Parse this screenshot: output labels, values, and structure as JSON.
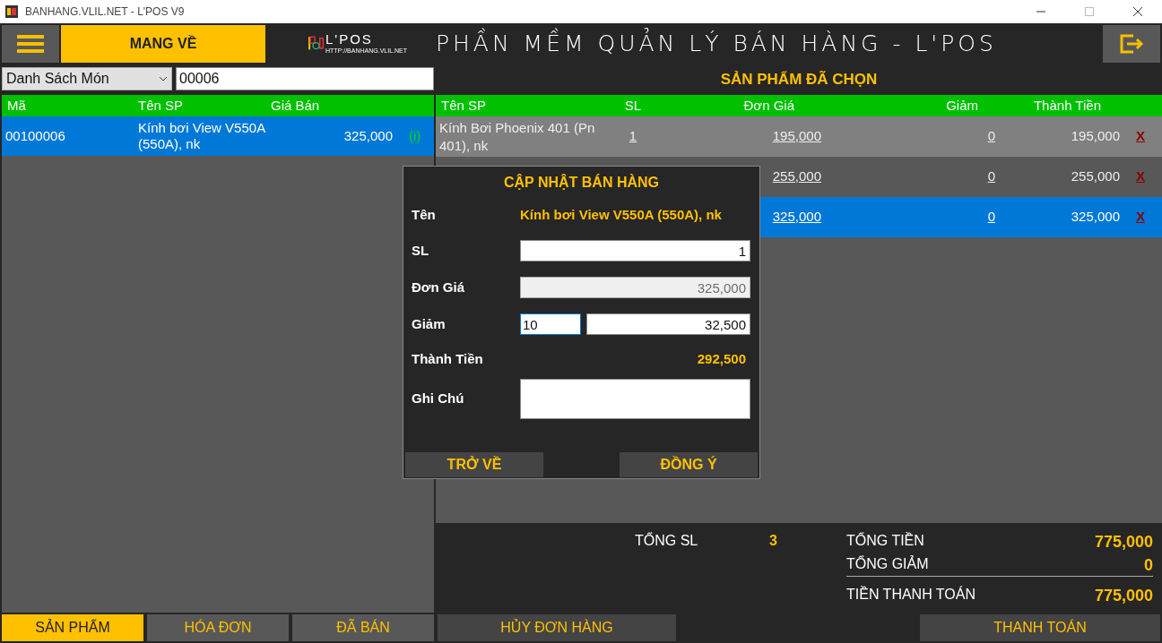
{
  "window": {
    "title": "BANHANG.VLIL.NET - L'POS V9"
  },
  "top_bar": {
    "order_type": "MANG VỀ",
    "logo_text": "L'POS",
    "logo_url": "HTTP://BANHANG.VLIL.NET",
    "app_title": "PHẦN MỀM QUẢN LÝ BÁN HÀNG - L'POS"
  },
  "product_panel": {
    "category": "Danh Sách Món",
    "search": "00006",
    "columns": [
      "Mã",
      "Tên SP",
      "Giá Bán"
    ],
    "rows": [
      {
        "code": "00100006",
        "name": "Kính bơi View V550A (550A), nk",
        "price": "325,000",
        "info": "(i)",
        "selected": true
      }
    ]
  },
  "cart": {
    "title": "SẢN PHẨM ĐÃ CHỌN",
    "columns": [
      "Tên SP",
      "SL",
      "Đơn Giá",
      "Giảm",
      "Thành Tiền"
    ],
    "rows": [
      {
        "name": "Kính Bơi Phoenix 401 (Pn 401), nk",
        "qty": "1",
        "unit_price": "195,000",
        "discount": "0",
        "total": "195,000",
        "remove": "X",
        "selected": false
      },
      {
        "unit_price": "255,000",
        "discount": "0",
        "total": "255,000",
        "remove": "X",
        "selected": false
      },
      {
        "unit_price": "325,000",
        "discount": "0",
        "total": "325,000",
        "remove": "X",
        "selected": true
      }
    ]
  },
  "summary": {
    "qty_label": "TỔNG SL",
    "qty": "3",
    "total_label": "TỔNG TIỀN",
    "total": "775,000",
    "discount_label": "TỔNG GIẢM",
    "discount": "0",
    "pay_label": "TIỀN THANH TOÁN",
    "pay": "775,000"
  },
  "dialog": {
    "title": "CẬP NHẬT BÁN HÀNG",
    "name_label": "Tên",
    "name": "Kính bơi View V550A (550A), nk",
    "qty_label": "SL",
    "qty": "1",
    "price_label": "Đơn Giá",
    "price": "325,000",
    "price_disabled": true,
    "discount_label": "Giảm",
    "discount_percent": "10",
    "discount_amount": "32,500",
    "total_label": "Thành Tiền",
    "total": "292,500",
    "note_label": "Ghi Chú",
    "buttons": [
      "TRỞ VỀ",
      "ĐỒNG Ý"
    ]
  },
  "tabs": [
    {
      "label": "SẢN PHẨM",
      "selected": true
    },
    {
      "label": "HÓA ĐƠN",
      "selected": false
    },
    {
      "label": "ĐÃ BÁN",
      "selected": false
    }
  ],
  "actions": {
    "cancel": "HỦY ĐƠN HÀNG",
    "pay": "THANH TOÁN"
  }
}
